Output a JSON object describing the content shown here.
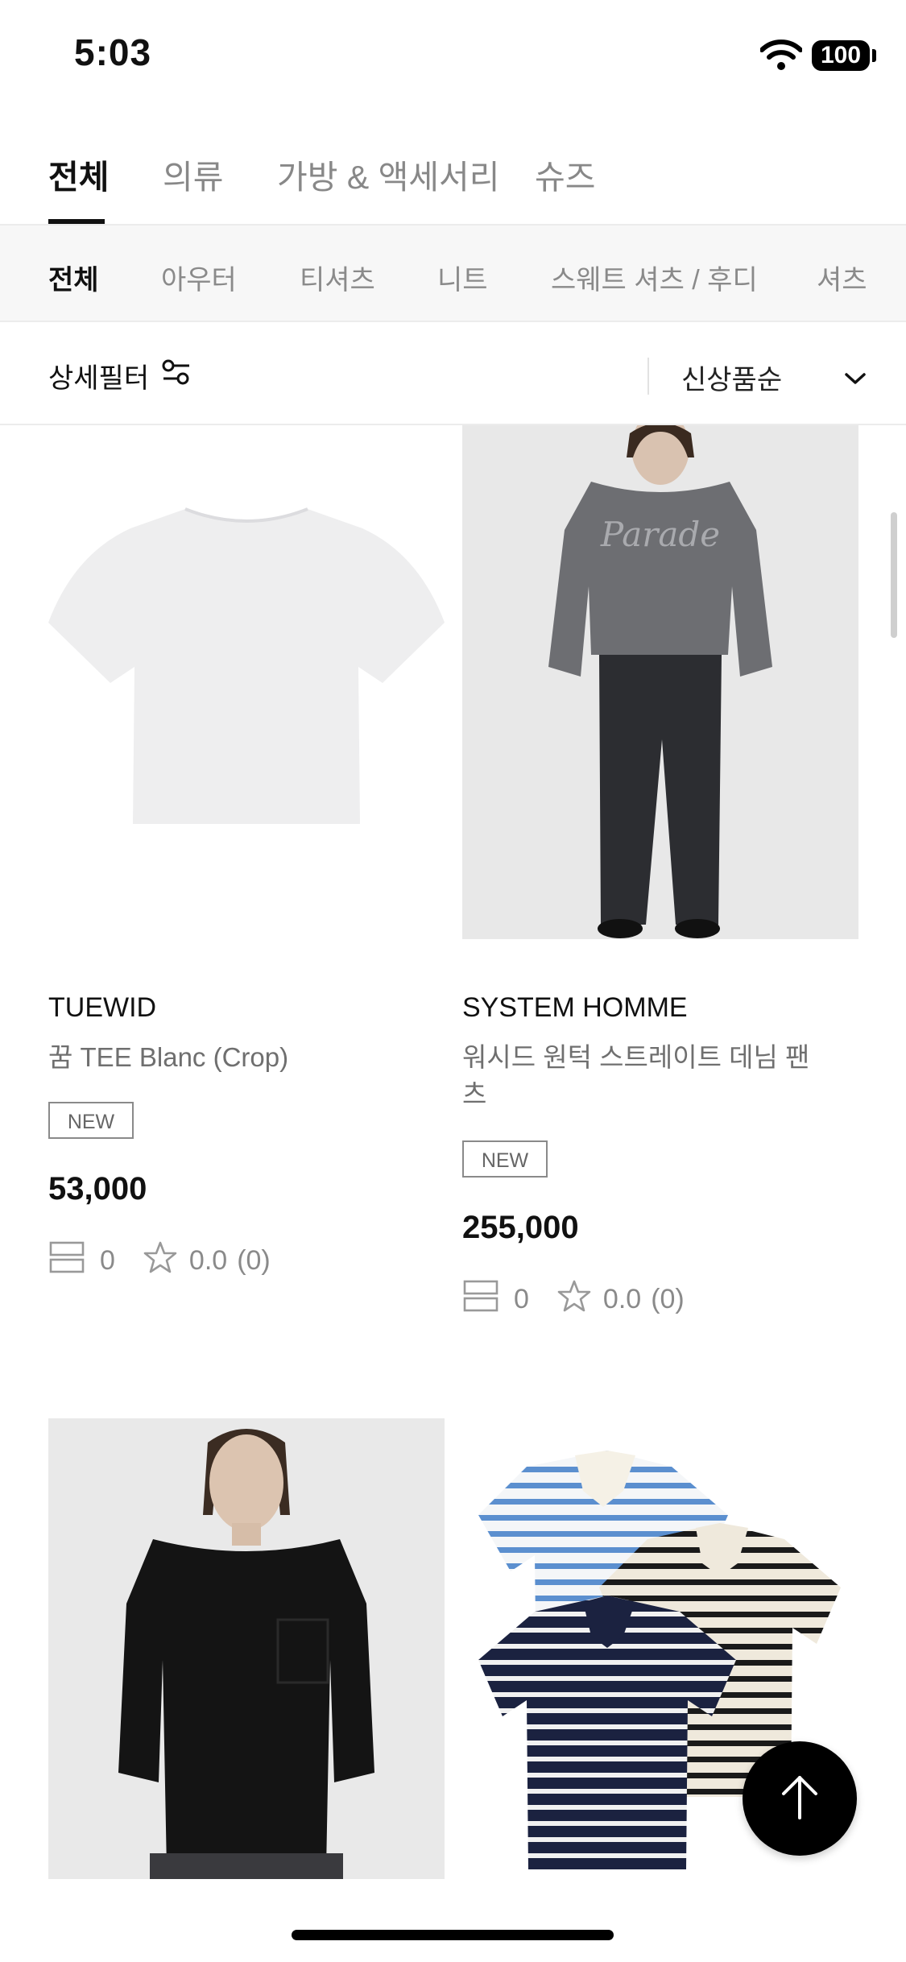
{
  "status": {
    "time": "5:03",
    "battery": "100"
  },
  "main_tabs": [
    {
      "label": "전체",
      "active": true
    },
    {
      "label": "의류"
    },
    {
      "label": "가방 & 액세서리"
    },
    {
      "label": "슈즈"
    }
  ],
  "sub_tabs": [
    {
      "label": "전체",
      "active": true
    },
    {
      "label": "아우터"
    },
    {
      "label": "티셔츠"
    },
    {
      "label": "니트"
    },
    {
      "label": "스웨트 셔츠 / 후디"
    },
    {
      "label": "셔츠"
    }
  ],
  "filter": {
    "label": "상세필터",
    "icon": "filter-sliders-icon"
  },
  "sort": {
    "label": "신상품순",
    "icon": "chevron-down-icon"
  },
  "products": [
    {
      "brand": "TUEWID",
      "name": "꿈 TEE Blanc (Crop)",
      "badge": "NEW",
      "price": "53,000",
      "likes": "0",
      "rating": "0.0",
      "reviews": "(0)"
    },
    {
      "brand": "SYSTEM HOMME",
      "name": "워시드 원턱 스트레이트 데님 팬츠",
      "badge": "NEW",
      "price": "255,000",
      "likes": "0",
      "rating": "0.0",
      "reviews": "(0)",
      "sweater_print": "Parade"
    }
  ],
  "colors": {
    "accent": "#111111",
    "muted": "#8a8a8a",
    "subtab_bg": "#f7f7f7"
  }
}
